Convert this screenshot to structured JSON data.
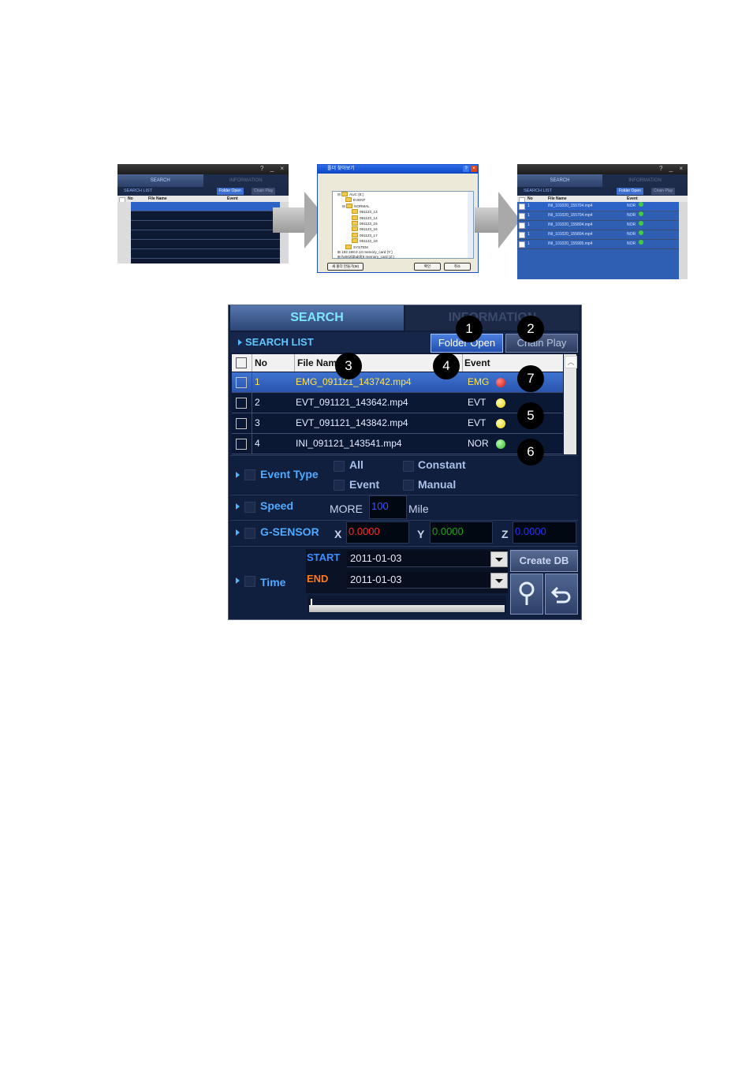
{
  "thumb1": {
    "tabs": [
      "SEARCH",
      "INFORMATION"
    ],
    "list_title": "SEARCH LIST",
    "btn_folder": "Folder Open",
    "btn_chain": "Chain Play",
    "cols": [
      "No",
      "File Name",
      "Event"
    ]
  },
  "dialog": {
    "title": "폴더 찾아보기",
    "tree": [
      "AUC (E:)",
      "EVENT",
      "NORMAL",
      "091123_13",
      "091123_14",
      "091123_15",
      "091123_16",
      "091123_17",
      "091123_18",
      "SYSTEM",
      "192.168.0.13 memory_card (Y:)",
      "fw002fdbd0f(9 memory_card (Z:)"
    ],
    "btn_new": "새 폴더 만들기(M)",
    "btn_ok": "확인",
    "btn_cancel": "취소"
  },
  "thumb3": {
    "tabs": [
      "SEARCH",
      "INFORMATION"
    ],
    "list_title": "SEARCH LIST",
    "btn_folder": "Folder Open",
    "btn_chain": "Chain Play",
    "cols": [
      "No",
      "File Name",
      "Event"
    ],
    "rows": [
      {
        "no": "1",
        "file": "INI_101020_155704.mp4",
        "event": "NOR"
      },
      {
        "no": "1",
        "file": "INI_101020_155704.mp4",
        "event": "NOR"
      },
      {
        "no": "1",
        "file": "INI_101020_155804.mp4",
        "event": "NOR"
      },
      {
        "no": "1",
        "file": "INI_101020_155804.mp4",
        "event": "NOR"
      },
      {
        "no": "1",
        "file": "INI_101020_155905.mp4",
        "event": "NOR"
      }
    ]
  },
  "panel": {
    "tab_search": "SEARCH",
    "tab_info": "INFORMATION",
    "list_title": "SEARCH LIST",
    "btn_folder_open": "Folder Open",
    "btn_chain_play": "Chain Play",
    "col_no": "No",
    "col_file": "File Name",
    "col_event": "Event",
    "rows": [
      {
        "no": "1",
        "file": "EMG_091121_143742.mp4",
        "event": "EMG",
        "color": "#e0201a"
      },
      {
        "no": "2",
        "file": "EVT_091121_143642.mp4",
        "event": "EVT",
        "color": "#f3e21d"
      },
      {
        "no": "3",
        "file": "EVT_091121_143842.mp4",
        "event": "EVT",
        "color": "#f3e21d"
      },
      {
        "no": "4",
        "file": "INI_091121_143541.mp4",
        "event": "NOR",
        "color": "#3fce3f"
      }
    ],
    "event_type_label": "Event Type",
    "opt_all": "All",
    "opt_constant": "Constant",
    "opt_event": "Event",
    "opt_manual": "Manual",
    "speed_label": "Speed",
    "speed_more": "MORE",
    "speed_value": "100",
    "speed_unit": "Mile",
    "gsensor_label": "G-SENSOR",
    "axis_x": "X",
    "axis_y": "Y",
    "axis_z": "Z",
    "gx": "0.0000",
    "gy": "0.0000",
    "gz": "0.0000",
    "time_label": "Time",
    "start_label": "START",
    "end_label": "END",
    "start_date": "2011-01-03",
    "end_date": "2011-01-03",
    "btn_create_db": "Create DB"
  },
  "callouts": [
    "1",
    "2",
    "3",
    "4",
    "5",
    "6",
    "7"
  ],
  "colors": {
    "accent": "#5fc7ff",
    "gx": "#ff2a2a",
    "gy": "#19a519",
    "gz": "#2233ff"
  }
}
